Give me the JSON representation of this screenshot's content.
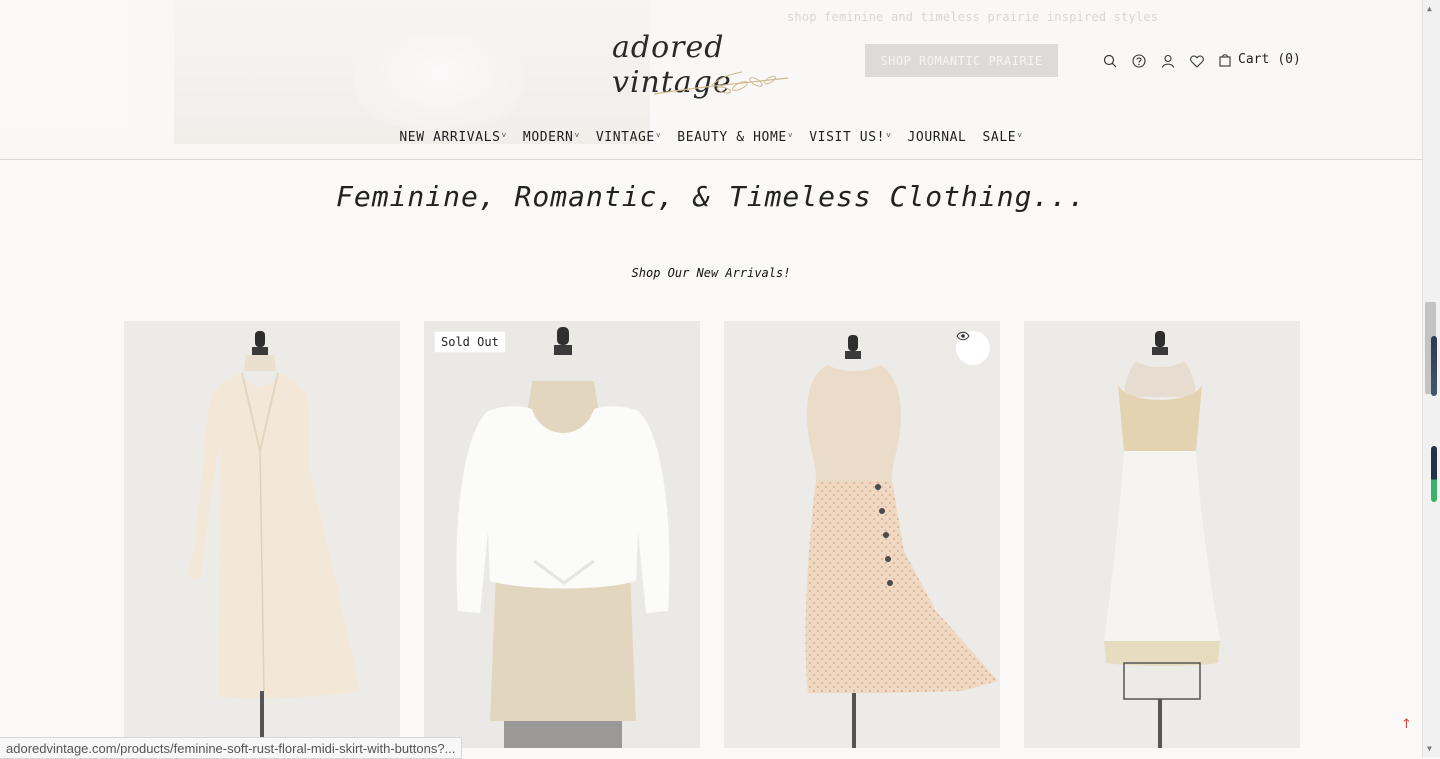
{
  "header": {
    "tagline": "shop feminine and timeless prairie inspired styles",
    "logo_text": "adored vintage",
    "cta_label": "SHOP ROMANTIC PRAIRIE",
    "icons": [
      "search-icon",
      "help-icon",
      "account-icon",
      "wishlist-icon",
      "cart-icon"
    ],
    "cart_label": "Cart",
    "cart_count": "(0)"
  },
  "nav": {
    "items": [
      {
        "label": "NEW ARRIVALS",
        "has_dropdown": true
      },
      {
        "label": "MODERN",
        "has_dropdown": true
      },
      {
        "label": "VINTAGE",
        "has_dropdown": true
      },
      {
        "label": "BEAUTY & HOME",
        "has_dropdown": true
      },
      {
        "label": "VISIT US!",
        "has_dropdown": true
      },
      {
        "label": "JOURNAL",
        "has_dropdown": false
      },
      {
        "label": "SALE",
        "has_dropdown": true
      }
    ]
  },
  "main": {
    "title": "Feminine, Romantic, & Timeless Clothing...",
    "subtitle": "Shop Our New Arrivals!",
    "products": [
      {
        "badge": "",
        "quick_view": false,
        "garment": "cream-dress"
      },
      {
        "badge": "Sold Out",
        "quick_view": false,
        "garment": "white-blouse"
      },
      {
        "badge": "",
        "quick_view": true,
        "garment": "floral-skirt"
      },
      {
        "badge": "",
        "quick_view": false,
        "garment": "lace-slip"
      }
    ]
  },
  "status_bar": {
    "url": "adoredvintage.com/products/feminine-soft-rust-floral-midi-skirt-with-buttons?..."
  },
  "colors": {
    "background": "#faf9f7",
    "cta_bg": "#dddbd8",
    "card_bg": "#ebe9e6",
    "back_to_top": "#d0463c"
  }
}
